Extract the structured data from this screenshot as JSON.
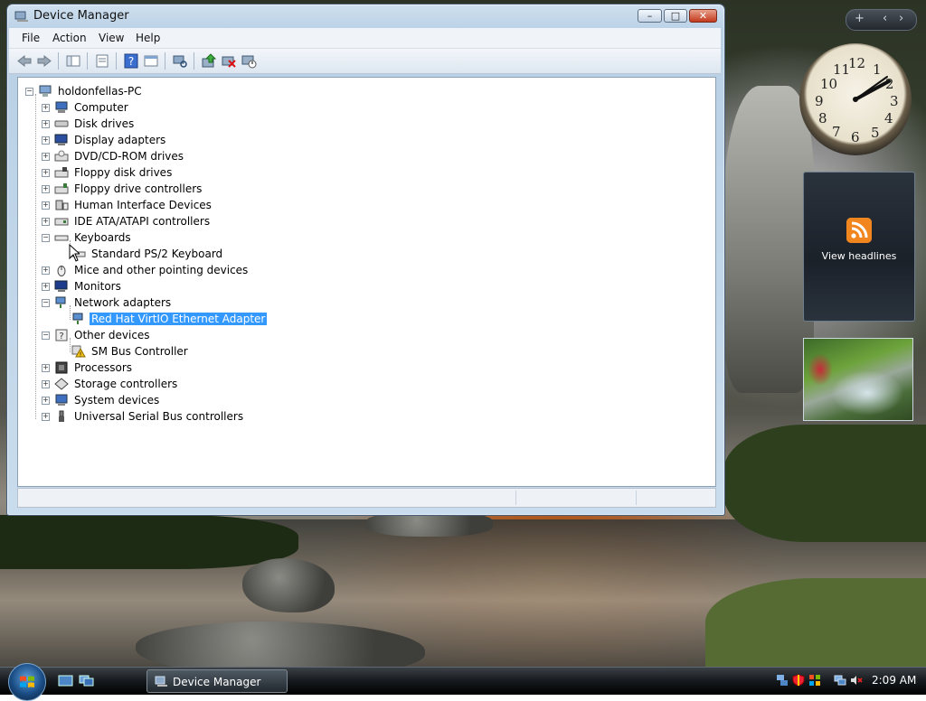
{
  "window": {
    "title": "Device Manager",
    "controls": {
      "minimize": "–",
      "maximize": "□",
      "close": "✕"
    }
  },
  "menu": [
    "File",
    "Action",
    "View",
    "Help"
  ],
  "toolbar": {
    "buttons": [
      "back-icon",
      "forward-icon",
      "console-tree-icon",
      "properties-icon",
      "help-icon",
      "details-icon",
      "scan-hardware-icon",
      "update-driver-icon",
      "uninstall-icon",
      "disable-icon"
    ]
  },
  "tree": {
    "root": "holdonfellas-PC",
    "items": [
      {
        "label": "Computer",
        "expanded": false
      },
      {
        "label": "Disk drives",
        "expanded": false
      },
      {
        "label": "Display adapters",
        "expanded": false
      },
      {
        "label": "DVD/CD-ROM drives",
        "expanded": false
      },
      {
        "label": "Floppy disk drives",
        "expanded": false
      },
      {
        "label": "Floppy drive controllers",
        "expanded": false
      },
      {
        "label": "Human Interface Devices",
        "expanded": false
      },
      {
        "label": "IDE ATA/ATAPI controllers",
        "expanded": false
      },
      {
        "label": "Keyboards",
        "expanded": true,
        "child": "Standard PS/2 Keyboard"
      },
      {
        "label": "Mice and other pointing devices",
        "expanded": false
      },
      {
        "label": "Monitors",
        "expanded": false
      },
      {
        "label": "Network adapters",
        "expanded": true,
        "child": "Red Hat VirtIO Ethernet Adapter"
      },
      {
        "label": "Other devices",
        "expanded": true,
        "child": "SM Bus Controller"
      },
      {
        "label": "Processors",
        "expanded": false
      },
      {
        "label": "Storage controllers",
        "expanded": false
      },
      {
        "label": "System devices",
        "expanded": false
      },
      {
        "label": "Universal Serial Bus controllers",
        "expanded": false
      }
    ],
    "selected": "Red Hat VirtIO Ethernet Adapter"
  },
  "gadgets": {
    "clock_numbers": [
      "12",
      "1",
      "2",
      "3",
      "4",
      "5",
      "6",
      "7",
      "8",
      "9",
      "10",
      "11"
    ],
    "feeds_label": "View headlines",
    "sidebar_controls": [
      "+",
      "‹",
      "›"
    ]
  },
  "taskbar": {
    "task_label": "Device Manager",
    "time": "2:09 AM"
  }
}
